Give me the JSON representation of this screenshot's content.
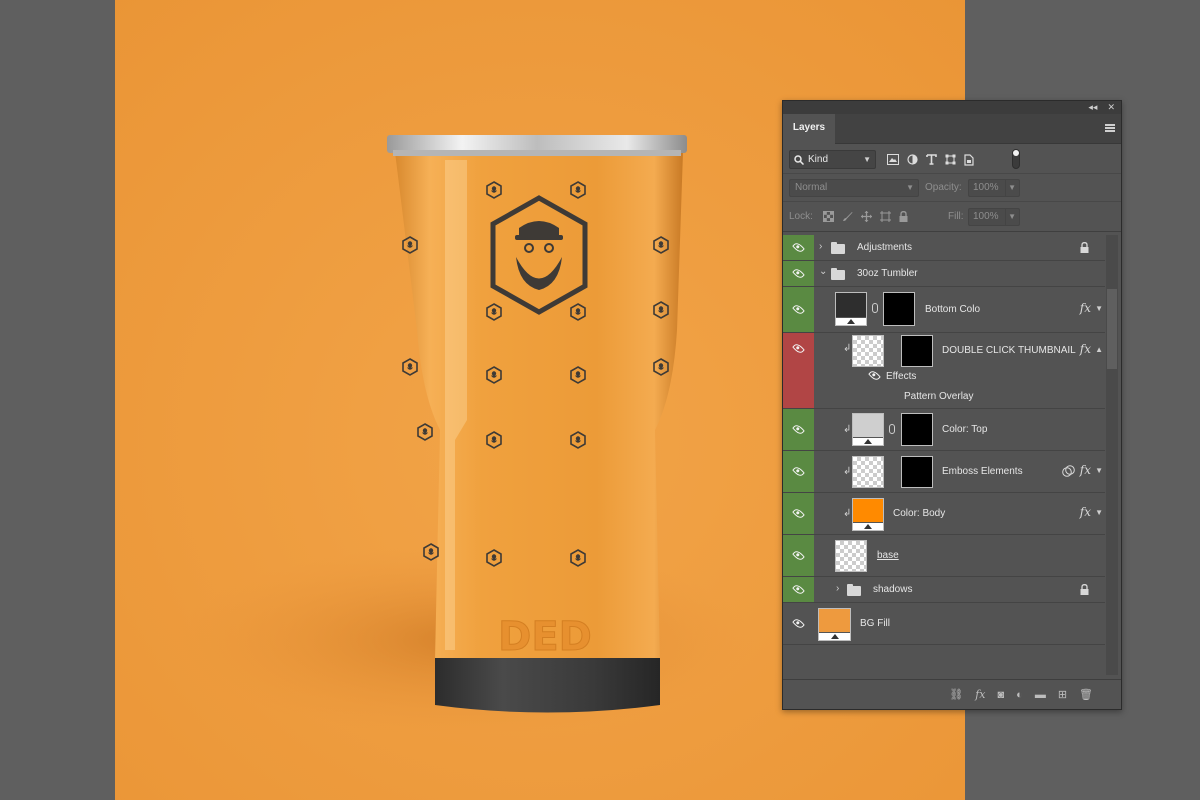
{
  "colors": {
    "canvas_background": "#ee9a3e",
    "tumbler_body": "#f0a13e",
    "tumbler_base": "#3c3c3c",
    "pattern_ink": "#3e3a36",
    "panel_background": "#535353",
    "visibility_green": "#5a8a42",
    "visibility_red": "#b14545"
  },
  "canvas": {
    "embossed_text": "DED"
  },
  "panel": {
    "collapse_glyph": "◂◂",
    "close_glyph": "✕",
    "tab_label": "Layers",
    "filter": {
      "kind_label": "Kind",
      "icons": [
        "image-filter-icon",
        "adjustment-filter-icon",
        "type-filter-icon",
        "shape-filter-icon",
        "smart-object-filter-icon"
      ]
    },
    "blend_mode": "Normal",
    "opacity_label": "Opacity:",
    "opacity_value": "100%",
    "lock_label": "Lock:",
    "fill_label": "Fill:",
    "fill_value": "100%",
    "layers": [
      {
        "name": "Adjustments",
        "kind": "group",
        "visible": true,
        "locked": true,
        "expanded": false
      },
      {
        "name": "30oz Tumbler",
        "kind": "group",
        "visible": true,
        "expanded": true
      },
      {
        "name": "Bottom Colo",
        "kind": "adjustment",
        "visible": true,
        "has_mask": true,
        "has_fx": true
      },
      {
        "name": "DOUBLE CLICK THUMBNAIL",
        "kind": "smart-object",
        "visible": true,
        "highlighted": true,
        "has_mask": true,
        "has_fx": true,
        "effects_label": "Effects",
        "effect_items": [
          "Pattern Overlay"
        ]
      },
      {
        "name": "Color: Top",
        "kind": "adjustment",
        "visible": true,
        "has_mask": true
      },
      {
        "name": "Emboss Elements",
        "kind": "smart-object",
        "visible": true,
        "has_mask": true,
        "has_fx": true
      },
      {
        "name": "Color: Body",
        "kind": "fill",
        "visible": true,
        "has_fx": true,
        "fill_color": "#ff8a00"
      },
      {
        "name": "base",
        "kind": "pixel",
        "visible": true
      },
      {
        "name": "shadows",
        "kind": "group",
        "visible": true,
        "locked": true,
        "expanded": false
      },
      {
        "name": "BG Fill",
        "kind": "fill",
        "visible": false,
        "fill_color": "#ee9a3e"
      }
    ],
    "footer_icons": [
      "link-layers-icon",
      "fx-icon",
      "add-mask-icon",
      "new-adjustment-icon",
      "new-group-icon",
      "new-layer-icon",
      "delete-layer-icon"
    ]
  }
}
